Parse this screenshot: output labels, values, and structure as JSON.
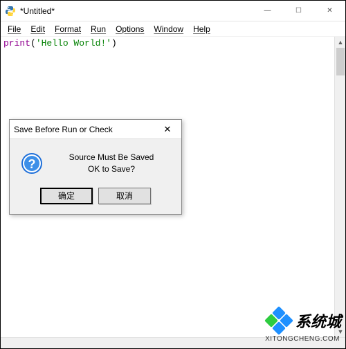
{
  "window": {
    "title": "*Untitled*",
    "controls": {
      "min": "—",
      "max": "☐",
      "close": "✕"
    }
  },
  "menu": {
    "file": "File",
    "edit": "Edit",
    "format": "Format",
    "run": "Run",
    "options": "Options",
    "window": "Window",
    "help": "Help"
  },
  "code": {
    "fn": "print",
    "open": "(",
    "str": "'Hello World!'",
    "close": ")"
  },
  "dialog": {
    "title": "Save Before Run or Check",
    "close": "✕",
    "message_line1": "Source Must Be Saved",
    "message_line2": "OK to Save?",
    "ok": "确定",
    "cancel": "取消"
  },
  "watermark": {
    "text": "系统城",
    "sub": "XITONGCHENG.COM",
    "colors": {
      "blue": "#1E90FF",
      "green": "#2ECC40"
    }
  }
}
